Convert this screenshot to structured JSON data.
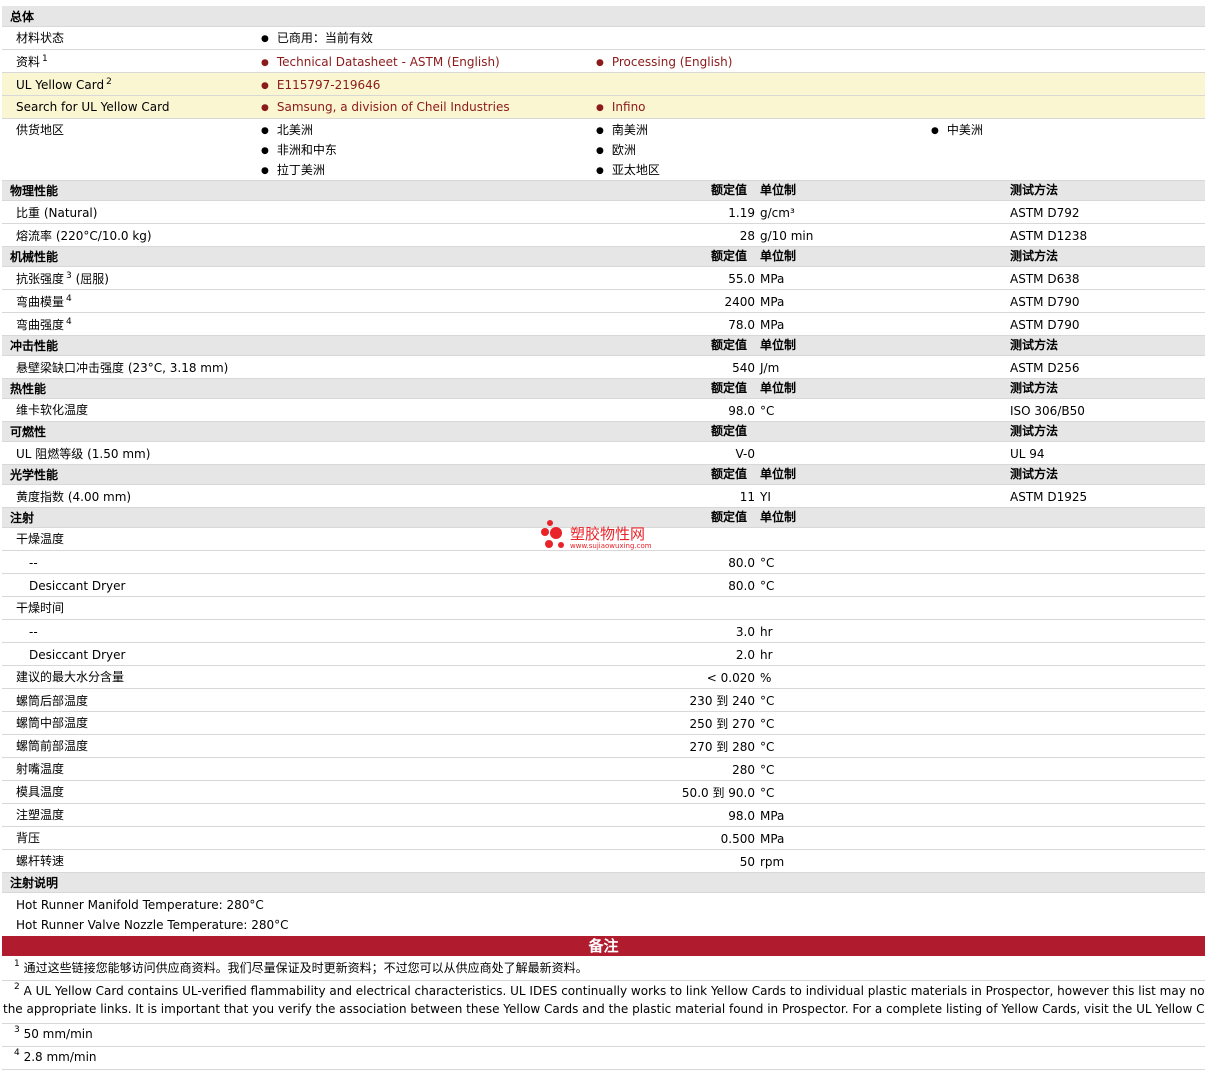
{
  "overview": {
    "section_title": "总体",
    "material_status_label": "材料状态",
    "material_status_value": "已商用：当前有效",
    "docs_label": "资料",
    "docs_sup": "1",
    "doc_link_1": "Technical Datasheet - ASTM (English)",
    "doc_link_2": "Processing (English)",
    "ul_label": "UL Yellow Card",
    "ul_sup": "2",
    "ul_value": "E115797-219646",
    "search_label": "Search for UL Yellow Card",
    "search_link_1": "Samsung, a division of Cheil Industries",
    "search_link_2": "Infino",
    "supply_label": "供货地区",
    "regions": [
      "北美洲",
      "南美洲",
      "中美洲",
      "非洲和中东",
      "欧洲",
      "拉丁美洲",
      "亚太地区"
    ]
  },
  "col_headers": {
    "rated": "额定值",
    "unit": "单位制",
    "method": "测试方法"
  },
  "physical": {
    "title": "物理性能",
    "rows": [
      {
        "name": "比重 (Natural)",
        "value": "1.19",
        "unit": "g/cm³",
        "method": "ASTM D792"
      },
      {
        "name": "熔流率 (220°C/10.0 kg)",
        "value": "28",
        "unit": "g/10 min",
        "method": "ASTM D1238"
      }
    ]
  },
  "mechanical": {
    "title": "机械性能",
    "rows": [
      {
        "name": "抗张强度",
        "sup": "3",
        "suffix": "(屈服)",
        "value": "55.0",
        "unit": "MPa",
        "method": "ASTM D638"
      },
      {
        "name": "弯曲模量",
        "sup": "4",
        "value": "2400",
        "unit": "MPa",
        "method": "ASTM D790"
      },
      {
        "name": "弯曲强度",
        "sup": "4",
        "value": "78.0",
        "unit": "MPa",
        "method": "ASTM D790"
      }
    ]
  },
  "impact": {
    "title": "冲击性能",
    "rows": [
      {
        "name": "悬壁梁缺口冲击强度 (23°C, 3.18 mm)",
        "value": "540",
        "unit": "J/m",
        "method": "ASTM D256"
      }
    ]
  },
  "thermal": {
    "title": "热性能",
    "rows": [
      {
        "name": "维卡软化温度",
        "value": "98.0",
        "unit": "°C",
        "method": "ISO 306/B50"
      }
    ]
  },
  "flammability": {
    "title": "可燃性",
    "rows": [
      {
        "name": "UL 阻燃等级 (1.50 mm)",
        "value": "V-0",
        "unit": "",
        "method": "UL 94"
      }
    ]
  },
  "optical": {
    "title": "光学性能",
    "rows": [
      {
        "name": "黄度指数 (4.00 mm)",
        "value": "11",
        "unit": "YI",
        "method": "ASTM D1925"
      }
    ]
  },
  "injection": {
    "title": "注射",
    "drying_temp_label": "干燥温度",
    "drying_temp_rows": [
      {
        "name": "--",
        "value": "80.0",
        "unit": "°C"
      },
      {
        "name": "Desiccant Dryer",
        "value": "80.0",
        "unit": "°C"
      }
    ],
    "drying_time_label": "干燥时间",
    "drying_time_rows": [
      {
        "name": "--",
        "value": "3.0",
        "unit": "hr"
      },
      {
        "name": "Desiccant Dryer",
        "value": "2.0",
        "unit": "hr"
      }
    ],
    "rows": [
      {
        "name": "建议的最大水分含量",
        "value": "< 0.020",
        "unit": "%"
      },
      {
        "name": "螺筒后部温度",
        "value": "230 到  240",
        "unit": "°C"
      },
      {
        "name": "螺筒中部温度",
        "value": "250 到  270",
        "unit": "°C"
      },
      {
        "name": "螺筒前部温度",
        "value": "270 到  280",
        "unit": "°C"
      },
      {
        "name": "射嘴温度",
        "value": "280",
        "unit": "°C"
      },
      {
        "name": "模具温度",
        "value": "50.0 到  90.0",
        "unit": "°C"
      },
      {
        "name": "注塑温度",
        "value": "98.0",
        "unit": "MPa"
      },
      {
        "name": "背压",
        "value": "0.500",
        "unit": "MPa"
      },
      {
        "name": "螺杆转速",
        "value": "50",
        "unit": "rpm"
      }
    ]
  },
  "injection_notes": {
    "title": "注射说明",
    "lines": [
      "Hot Runner Manifold Temperature: 280°C",
      "Hot Runner Valve Nozzle Temperature: 280°C"
    ]
  },
  "watermark": {
    "name": "塑胶物性网",
    "url": "www.sujiaowuxing.com"
  },
  "notes": {
    "title": "备注",
    "items": [
      {
        "num": "1",
        "text": "通过这些链接您能够访问供应商资料。我们尽量保证及时更新资料；不过您可以从供应商处了解最新资料。"
      },
      {
        "num": "2",
        "text": "A UL Yellow Card contains UL-verified flammability and electrical characteristics. UL IDES continually works to link Yellow Cards to individual plastic materials in Prospector, however this list may not includ",
        "text2": "the appropriate links. It is important that you verify the association between these Yellow Cards and the plastic material found in Prospector. For a complete listing of Yellow Cards, visit the UL Yellow Card Sea"
      },
      {
        "num": "3",
        "text": "50 mm/min"
      },
      {
        "num": "4",
        "text": "2.8 mm/min"
      }
    ]
  },
  "colors": {
    "link": "#8b1a1a",
    "notes_bar": "#b01b2e",
    "header_bg": "#e6e6e6",
    "yellow_bg": "#fbf6d2"
  }
}
